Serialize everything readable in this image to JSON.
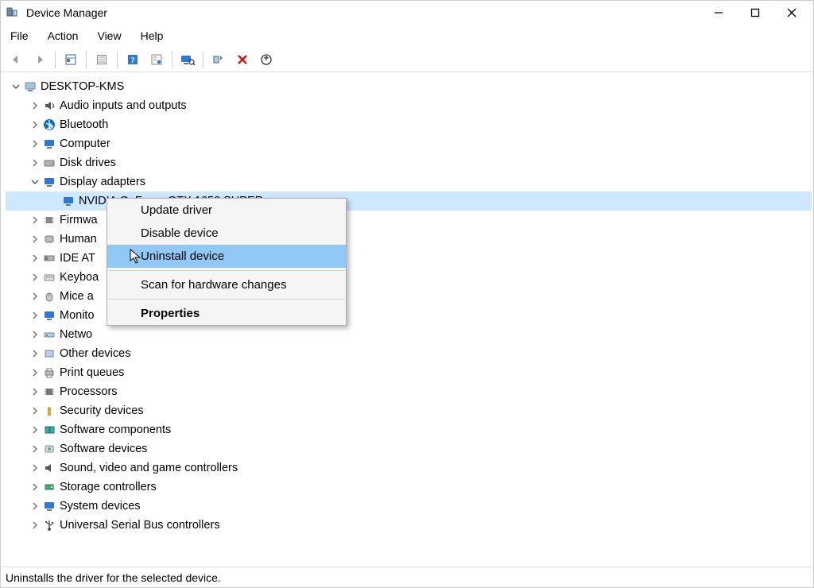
{
  "window": {
    "title": "Device Manager"
  },
  "menubar": {
    "file": "File",
    "action": "Action",
    "view": "View",
    "help": "Help"
  },
  "tree": {
    "root": "DESKTOP-KMS",
    "items": [
      {
        "label": "Audio inputs and outputs"
      },
      {
        "label": "Bluetooth"
      },
      {
        "label": "Computer"
      },
      {
        "label": "Disk drives"
      },
      {
        "label": "Display adapters"
      },
      {
        "label": "Firmwa"
      },
      {
        "label": "Human"
      },
      {
        "label": "IDE AT"
      },
      {
        "label": "Keyboa"
      },
      {
        "label": "Mice a"
      },
      {
        "label": "Monito"
      },
      {
        "label": "Netwo"
      },
      {
        "label": "Other devices"
      },
      {
        "label": "Print queues"
      },
      {
        "label": "Processors"
      },
      {
        "label": "Security devices"
      },
      {
        "label": "Software components"
      },
      {
        "label": "Software devices"
      },
      {
        "label": "Sound, video and game controllers"
      },
      {
        "label": "Storage controllers"
      },
      {
        "label": "System devices"
      },
      {
        "label": "Universal Serial Bus controllers"
      }
    ],
    "gpu": "NVIDIA GeForce GTX 1650 SUPER"
  },
  "context_menu": {
    "update": "Update driver",
    "disable": "Disable device",
    "uninstall": "Uninstall device",
    "scan": "Scan for hardware changes",
    "properties": "Properties"
  },
  "statusbar": {
    "text": "Uninstalls the driver for the selected device."
  }
}
